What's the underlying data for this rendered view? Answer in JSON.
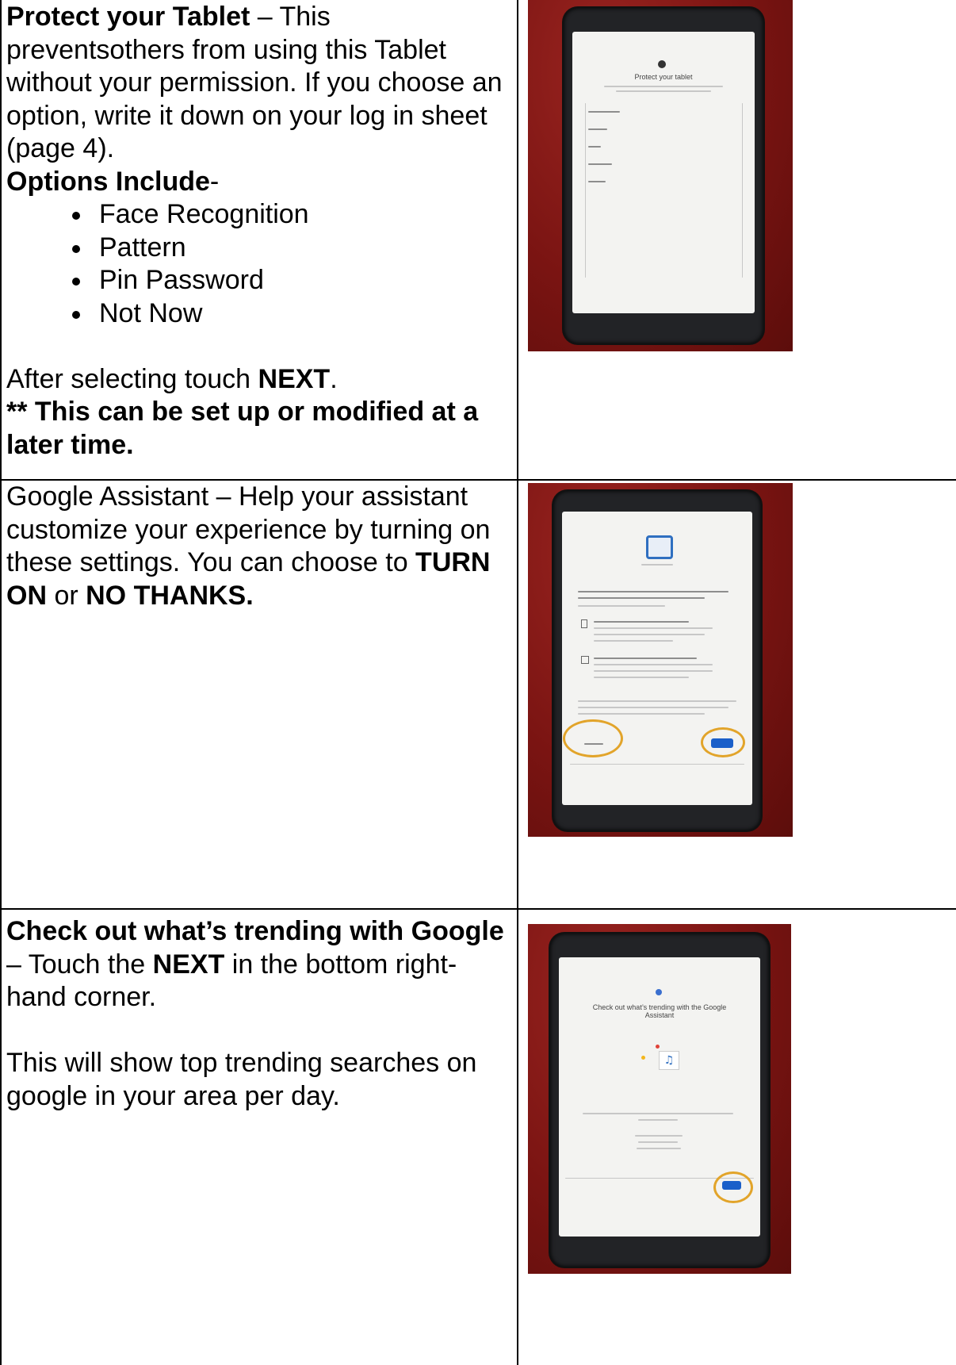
{
  "rows": [
    {
      "title_bold": "Protect your Tablet",
      "title_rest": " – This preventsothers from using this Tablet without your permission. If you choose an option, write it down on your log in sheet (page 4).",
      "options_heading": "Options Include",
      "options_dash": "-",
      "options": [
        "Face Recognition",
        "Pattern",
        "Pin Password",
        "Not Now"
      ],
      "after_prefix": "After selecting touch ",
      "after_bold": "NEXT",
      "after_suffix": ".",
      "note": "** This can be set up or modified at a later time.",
      "screen_title": "Protect your tablet"
    },
    {
      "text_1": "Google Assistant – Help your assistant customize your experience by turning on these settings. You can choose to ",
      "bold_1": "TURN ON",
      "text_2": " or ",
      "bold_2": "NO THANKS."
    },
    {
      "title_bold_1": "Check out what’s trending with Google",
      "title_rest": " – Touch the ",
      "title_bold_2": "NEXT",
      "title_rest_2": " in the bottom right-hand corner.",
      "para_2": "This will show top trending searches on google in your area per day.",
      "screen_title": "Check out what’s trending with the Google Assistant",
      "music_icon": "♫"
    }
  ],
  "colors": {
    "photo_bg": "#7a1412",
    "tablet": "#222326",
    "screen": "#f3f3f1",
    "button": "#1a5fc9",
    "highlight_ring": "#e2a42a"
  }
}
